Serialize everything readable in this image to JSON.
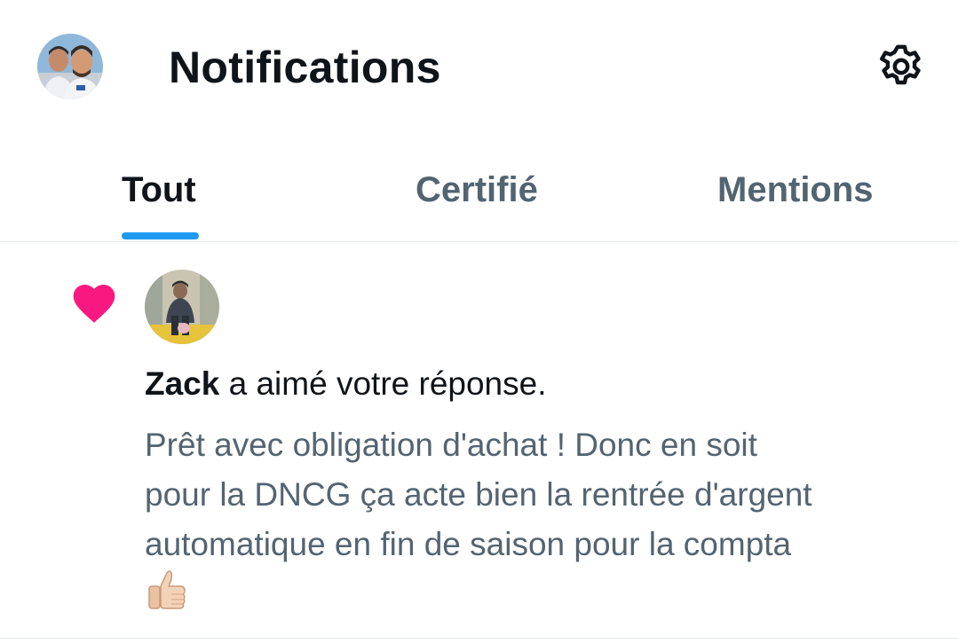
{
  "header": {
    "title": "Notifications",
    "avatar_icon": "profile-avatar-two-men",
    "settings_icon": "gear-icon"
  },
  "tabs": [
    {
      "label": "Tout",
      "active": true
    },
    {
      "label": "Certifié",
      "active": false
    },
    {
      "label": "Mentions",
      "active": false
    }
  ],
  "notifications": [
    {
      "type_icon": "heart-icon",
      "type_color": "#f91880",
      "user_name": "Zack",
      "action_text": " a aimé votre réponse.",
      "body_lines": [
        "Prêt avec obligation d'achat ! Donc en soit",
        "pour la DNCG ça acte bien la rentrée d'argent",
        "automatique en fin de saison pour la compta"
      ],
      "body_emoji": "thumbs-up-icon"
    }
  ],
  "colors": {
    "accent": "#1d9bf0",
    "text_primary": "#0f1419",
    "text_secondary": "#536471",
    "like": "#f91880",
    "divider": "#e3e7ea"
  }
}
